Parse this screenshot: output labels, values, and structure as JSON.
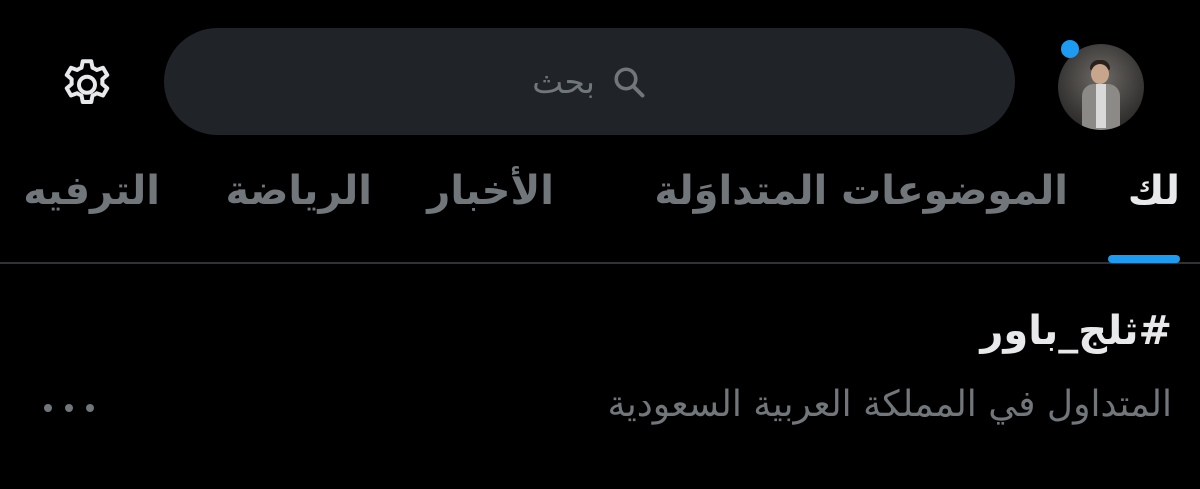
{
  "header": {
    "search": {
      "placeholder": "بحث",
      "icon": "search-icon"
    },
    "settings_icon": "gear-icon",
    "avatar_icon": "avatar",
    "notification_dot_color": "#1d9bf0"
  },
  "tabs": [
    {
      "label": "لك",
      "active": true
    },
    {
      "label": "الموضوعات المتداوَلة",
      "active": false
    },
    {
      "label": "الأخبار",
      "active": false
    },
    {
      "label": "الرياضة",
      "active": false
    },
    {
      "label": "الترفيه",
      "active": false
    }
  ],
  "trend": {
    "name": "#ثلج_باور",
    "context": "المتداول في المملكة العربية السعودية",
    "more_icon": "more-horizontal-icon"
  },
  "colors": {
    "background": "#000000",
    "accent": "#1d9bf0",
    "primary_text": "#e7e9ea",
    "secondary_text": "#71767b",
    "search_bg": "#202327"
  }
}
